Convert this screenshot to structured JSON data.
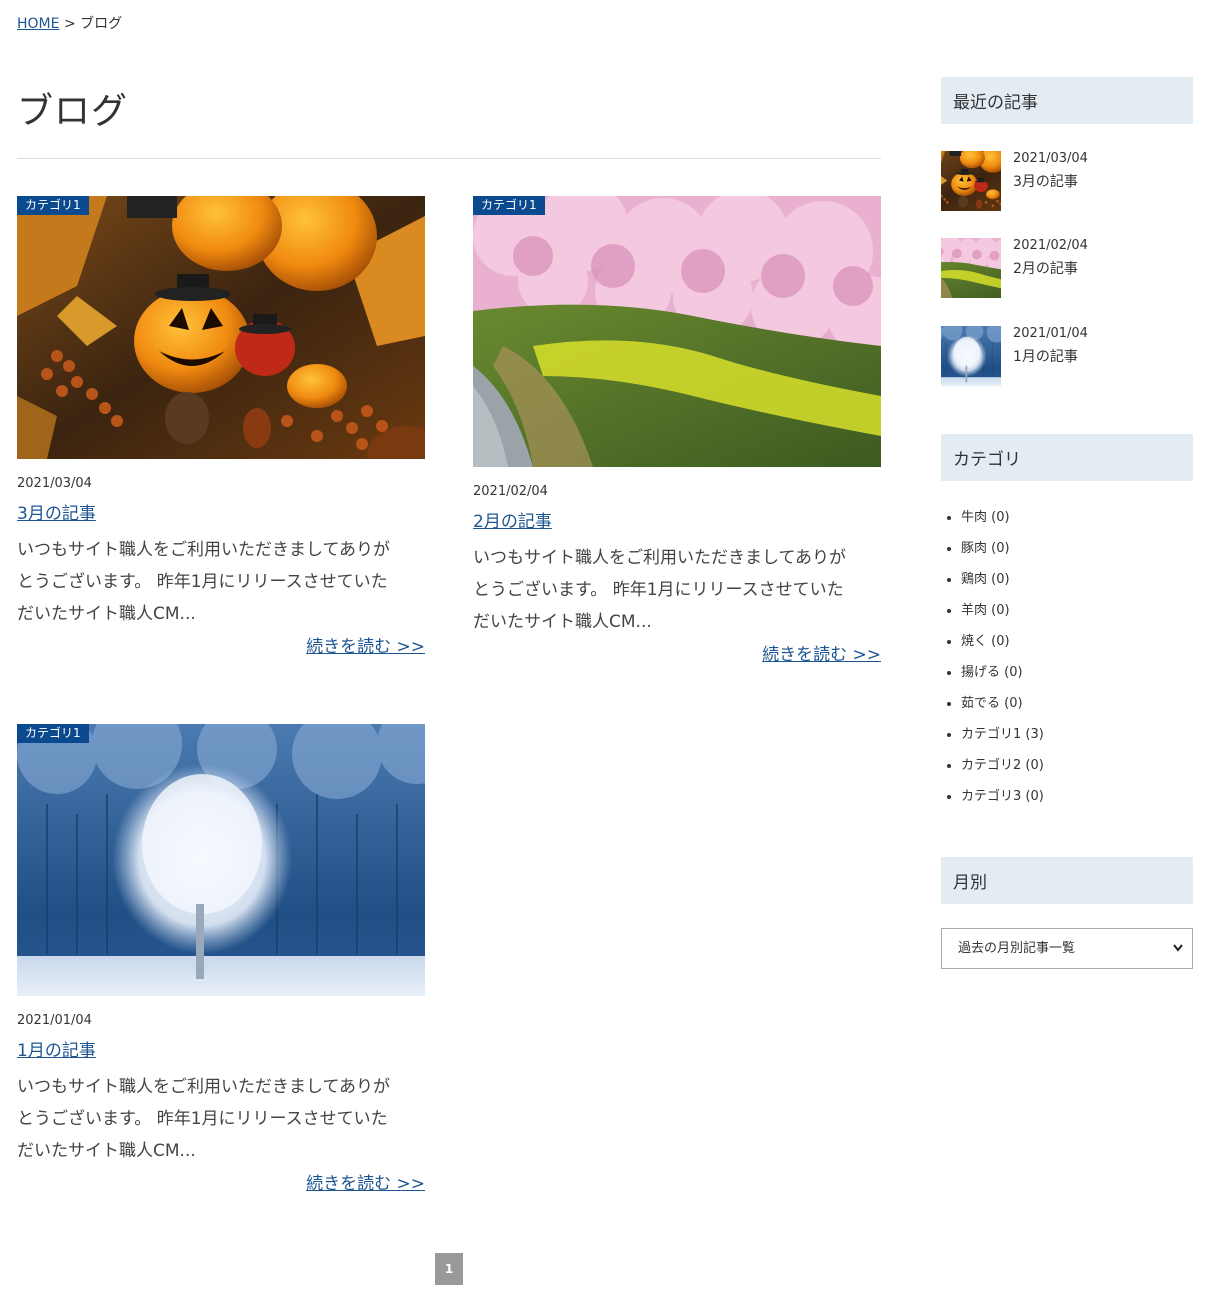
{
  "breadcrumb": {
    "home": "HOME",
    "separator": ">",
    "current": "ブログ"
  },
  "page_title": "ブログ",
  "posts": [
    {
      "category": "カテゴリ1",
      "date": "2021/03/04",
      "title": "3月の記事",
      "excerpt_lines": [
        "いつもサイト職人をご利用いただきましてありが",
        "とうございます。 昨年1月にリリースさせていた",
        "だいたサイト職人CM..."
      ],
      "more": "続きを読む >>",
      "image": "halloween-pumpkins"
    },
    {
      "category": "カテゴリ1",
      "date": "2021/02/04",
      "title": "2月の記事",
      "excerpt_lines": [
        "いつもサイト職人をご利用いただきましてありが",
        "とうございます。 昨年1月にリリースさせていた",
        "だいたサイト職人CM..."
      ],
      "more": "続きを読む >>",
      "image": "cherry-blossoms-river"
    },
    {
      "category": "カテゴリ1",
      "date": "2021/01/04",
      "title": "1月の記事",
      "excerpt_lines": [
        "いつもサイト職人をご利用いただきましてありが",
        "とうございます。 昨年1月にリリースさせていた",
        "だいたサイト職人CM..."
      ],
      "more": "続きを読む >>",
      "image": "frosted-tree"
    }
  ],
  "pagination": {
    "current": "1"
  },
  "sidebar": {
    "recent_heading": "最近の記事",
    "recent": [
      {
        "date": "2021/03/04",
        "title": "3月の記事"
      },
      {
        "date": "2021/02/04",
        "title": "2月の記事"
      },
      {
        "date": "2021/01/04",
        "title": "1月の記事"
      }
    ],
    "category_heading": "カテゴリ",
    "categories": [
      "牛肉 (0)",
      "豚肉 (0)",
      "鶏肉 (0)",
      "羊肉 (0)",
      "焼く (0)",
      "揚げる (0)",
      "茹でる (0)",
      "カテゴリ1 (3)",
      "カテゴリ2 (0)",
      "カテゴリ3 (0)"
    ],
    "monthly_heading": "月別",
    "monthly_select": "過去の月別記事一覧"
  },
  "colors": {
    "link": "#1d5593",
    "badge": "#0b4a8f",
    "sidebar_head": "#e3ebf3",
    "pager": "#999999"
  }
}
